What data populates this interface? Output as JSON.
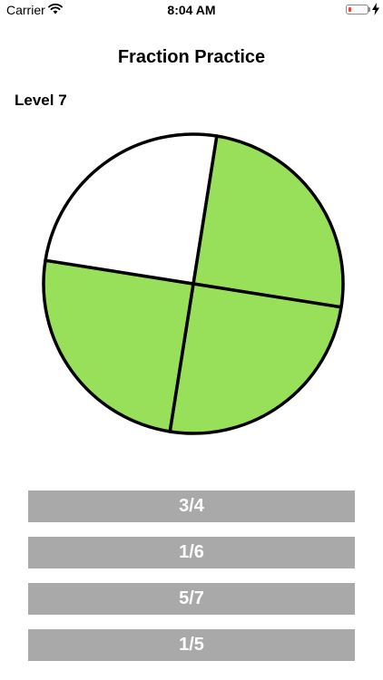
{
  "status_bar": {
    "carrier": "Carrier",
    "time": "8:04 AM",
    "battery_color": "#ff3b30"
  },
  "title": "Fraction Practice",
  "level": "Level 7",
  "pie": {
    "parts_total": 4,
    "parts_shaded": 3,
    "shaded_color": "#98e05a",
    "unshaded_color": "#ffffff",
    "outline_color": "#000000"
  },
  "answers": [
    {
      "label": "3/4"
    },
    {
      "label": "1/6"
    },
    {
      "label": "5/7"
    },
    {
      "label": "1/5"
    }
  ]
}
